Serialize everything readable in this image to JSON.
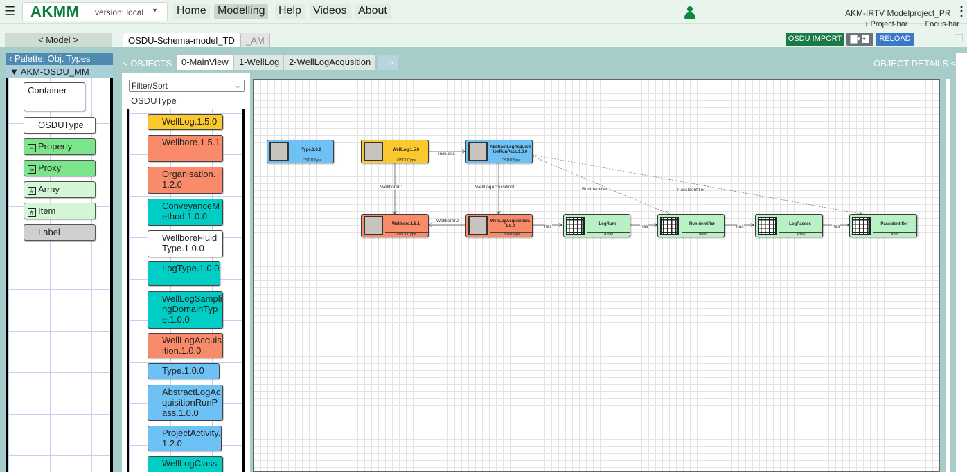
{
  "topbar": {
    "brand": "AKMM",
    "version": "version: local",
    "nav": [
      "Home",
      "Modelling",
      "Help",
      "Videos",
      "About"
    ],
    "active_nav": "Modelling",
    "project": "AKM-IRTV Modelproject_PR",
    "project_bar_hint": "↓ Project-bar",
    "focus_bar_hint": "↓ Focus-bar"
  },
  "toolbar": {
    "model_button": "< Model >",
    "file_tabs": [
      "OSDU-Schema-model_TD",
      "_AM"
    ],
    "import_label": "OSDU IMPORT",
    "reload_label": "RELOAD"
  },
  "palette": {
    "header": "Palette: Obj. Types",
    "metamodel": "AKM-OSDU_MM",
    "items": [
      {
        "label": "Container",
        "icon": "none",
        "color": "#ffffff"
      },
      {
        "label": "OSDUType",
        "icon": "none",
        "color": "#ffffff"
      },
      {
        "label": "Property",
        "icon": "property-icon",
        "color": "#7be58b"
      },
      {
        "label": "Proxy",
        "icon": "proxy-icon",
        "color": "#7be58b"
      },
      {
        "label": "Array",
        "icon": "grid-icon",
        "color": "#d3f7d6"
      },
      {
        "label": "Item",
        "icon": "grid-icon",
        "color": "#d3f7d6"
      },
      {
        "label": "Label",
        "icon": "none",
        "color": "#d0d0d0"
      }
    ]
  },
  "views": {
    "objects_toggle": "< OBJECTS",
    "tabs": [
      "0-MainView",
      "1-WellLog",
      "2-WellLogAcqusition"
    ],
    "help": "?",
    "details_toggle": "OBJECT DETAILS <"
  },
  "objects_panel": {
    "filter_placeholder": "Filter/Sort",
    "type_label": "OSDUType",
    "items": [
      {
        "label": "WellLog.1.5.0",
        "color": "#fbc92e"
      },
      {
        "label": "Wellbore.1.5.1",
        "color": "#f98a6a"
      },
      {
        "label": "Organisation.1.2.0",
        "color": "#f98a6a"
      },
      {
        "label": "ConveyanceMethod.1.0.0",
        "color": "#00cdc3"
      },
      {
        "label": "WellboreFluidType.1.0.0",
        "color": "#ffffff"
      },
      {
        "label": "LogType.1.0.0",
        "color": "#00cdc3"
      },
      {
        "label": "WellLogSamplingDomainType.1.0.0",
        "color": "#00cdc3"
      },
      {
        "label": "WellLogAcquisition.1.0.0",
        "color": "#f98a6a"
      },
      {
        "label": "Type.1.0.0",
        "color": "#6ec1f5"
      },
      {
        "label": "AbstractLogAcquisitionRunPass.1.0.0",
        "color": "#6ec1f5"
      },
      {
        "label": "ProjectActivity.1.2.0",
        "color": "#6ec1f5"
      },
      {
        "label": "WellLogClass",
        "color": "#00cdc3"
      }
    ]
  },
  "diagram": {
    "nodes": [
      {
        "id": "type",
        "name": "Type.1.0.0",
        "type": "OSDUType",
        "color": "#6ec1f5"
      },
      {
        "id": "welllog",
        "name": "WellLog.1.5.0",
        "type": "OSDUType",
        "color": "#fbc92e"
      },
      {
        "id": "abstract",
        "name": "AbstractLogAcquisitionRunPass.1.0.0",
        "type": "OSDUType",
        "color": "#6ec1f5"
      },
      {
        "id": "wellbore",
        "name": "Wellbore.1.5.1",
        "type": "OSDUType",
        "color": "#f98a6a"
      },
      {
        "id": "acq",
        "name": "WellLogAcquisition.1.0.0",
        "type": "OSDUType",
        "color": "#f98a6a"
      },
      {
        "id": "logruns",
        "name": "LogRuns",
        "type": "Array",
        "color": "#b8f2c4"
      },
      {
        "id": "runid",
        "name": "RunIdentifier",
        "type": "Item",
        "color": "#b8f2c4"
      },
      {
        "id": "logpasses",
        "name": "LogPasses",
        "type": "Array",
        "color": "#b8f2c4"
      },
      {
        "id": "passid",
        "name": "PassIdentifier",
        "type": "Item",
        "color": "#b8f2c4"
      }
    ],
    "edges": [
      {
        "from": "welllog",
        "to": "abstract",
        "label": "includes"
      },
      {
        "from": "welllog",
        "to": "wellbore",
        "label": "WellboreID"
      },
      {
        "from": "abstract",
        "to": "acq",
        "label": "WellLogAcquisitionID"
      },
      {
        "from": "acq",
        "to": "wellbore",
        "label": "WellboreID"
      },
      {
        "from": "acq",
        "to": "logruns",
        "label": "has"
      },
      {
        "from": "logruns",
        "to": "runid",
        "label": "has"
      },
      {
        "from": "runid",
        "to": "logpasses",
        "label": "has"
      },
      {
        "from": "logpasses",
        "to": "passid",
        "label": "has"
      },
      {
        "from": "abstract",
        "to": "runid",
        "label": "RunIdentifier"
      },
      {
        "from": "abstract",
        "to": "passid",
        "label": "PassIdentifier"
      }
    ]
  }
}
